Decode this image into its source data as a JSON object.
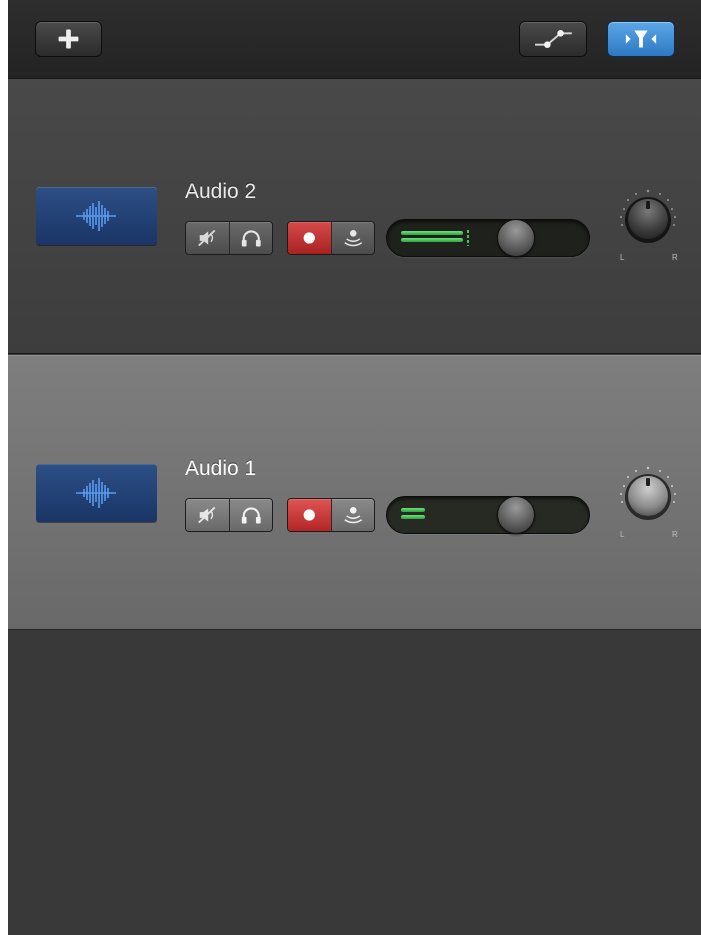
{
  "toolbar": {
    "add_icon": "plus-icon",
    "automation_icon": "automation-curve-icon",
    "filter_icon": "funnel-filter-icon",
    "accent": "#3b8bd8"
  },
  "tracks": [
    {
      "name": "Audio 2",
      "selected": false,
      "mute_icon": "speaker-mute-icon",
      "solo_icon": "headphones-icon",
      "record_icon": "record-icon",
      "monitor_icon": "input-monitor-icon",
      "volume_level": 0.66,
      "pan_labels": {
        "left": "L",
        "right": "R"
      },
      "pan_value": 0
    },
    {
      "name": "Audio 1",
      "selected": true,
      "mute_icon": "speaker-mute-icon",
      "solo_icon": "headphones-icon",
      "record_icon": "record-icon",
      "monitor_icon": "input-monitor-icon",
      "volume_level": 0.66,
      "pan_labels": {
        "left": "L",
        "right": "R"
      },
      "pan_value": 0
    }
  ],
  "colors": {
    "record_red": "#c83030",
    "meter_green": "#4bc05a",
    "waveform_blue": "#4a8ee8"
  }
}
